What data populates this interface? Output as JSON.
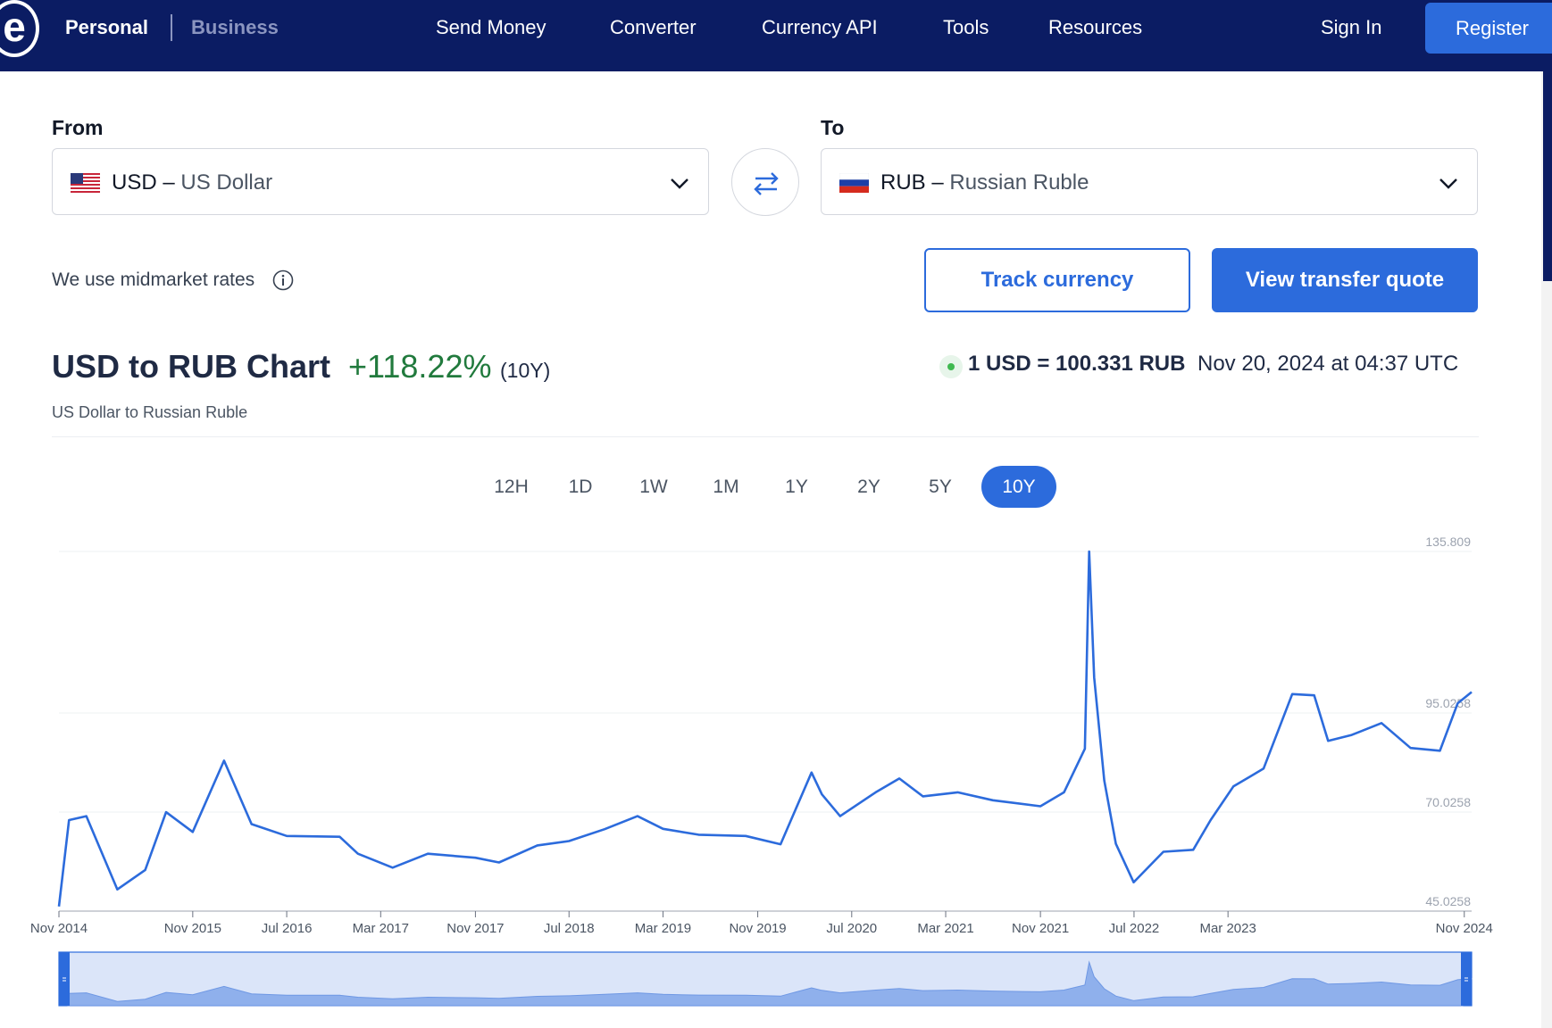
{
  "header": {
    "logo_letter": "e",
    "personal": "Personal",
    "business": "Business",
    "nav": [
      "Send Money",
      "Converter",
      "Currency API",
      "Tools",
      "Resources"
    ],
    "sign_in": "Sign In",
    "register": "Register",
    "bg_color": "#0b1c63"
  },
  "converter": {
    "from_label": "From",
    "from_code": "USD",
    "from_name": "US Dollar",
    "from_flag": "us-flag",
    "to_label": "To",
    "to_code": "RUB",
    "to_name": "Russian Ruble",
    "to_flag": "ru-flag",
    "dash": "–",
    "midmarket_text": "We use midmarket rates",
    "track_button": "Track currency",
    "quote_button": "View transfer quote",
    "accent": "#2c6bdc"
  },
  "chart_header": {
    "title": "USD to RUB Chart",
    "change": "+118.22%",
    "change_period": "(10Y)",
    "subtitle": "US Dollar to Russian Ruble",
    "rate": "1 USD = 100.331 RUB",
    "rate_time": "Nov 20, 2024 at 04:37 UTC",
    "change_color": "#217a3d"
  },
  "range_tabs": {
    "items": [
      "12H",
      "1D",
      "1W",
      "1M",
      "1Y",
      "2Y",
      "5Y",
      "10Y"
    ],
    "active": "10Y"
  },
  "chart_data": {
    "type": "line",
    "title": "USD to RUB Chart",
    "series": [
      {
        "name": "USD to RUB",
        "x": [
          "2014-11-20",
          "2014-12-16",
          "2015-01-30",
          "2015-04-20",
          "2015-07-01",
          "2015-08-24",
          "2015-11-01",
          "2016-01-21",
          "2016-04-01",
          "2016-07-01",
          "2016-11-15",
          "2017-01-01",
          "2017-04-01",
          "2017-07-01",
          "2017-11-01",
          "2018-01-01",
          "2018-04-10",
          "2018-07-01",
          "2018-10-01",
          "2018-12-25",
          "2019-03-01",
          "2019-06-01",
          "2019-10-01",
          "2019-12-30",
          "2020-03-19",
          "2020-04-15",
          "2020-06-01",
          "2020-09-01",
          "2020-11-01",
          "2021-01-01",
          "2021-04-01",
          "2021-07-01",
          "2021-11-01",
          "2022-01-01",
          "2022-02-24",
          "2022-03-07",
          "2022-03-20",
          "2022-04-15",
          "2022-05-15",
          "2022-06-30",
          "2022-09-15",
          "2022-12-01",
          "2023-01-15",
          "2023-03-15",
          "2023-06-01",
          "2023-08-14",
          "2023-10-10",
          "2023-11-15",
          "2024-01-15",
          "2024-04-01",
          "2024-06-15",
          "2024-08-30",
          "2024-10-15",
          "2024-11-20"
        ],
        "values": [
          46.2,
          68.0,
          69.0,
          50.5,
          55.4,
          70.0,
          65.0,
          83.0,
          67.0,
          64.0,
          63.8,
          59.5,
          56.0,
          59.5,
          58.5,
          57.3,
          61.6,
          62.7,
          65.7,
          69.0,
          65.8,
          64.3,
          64.0,
          61.9,
          80.0,
          74.5,
          69.0,
          75.0,
          78.5,
          74.0,
          75.0,
          73.0,
          71.5,
          75.0,
          86.0,
          135.8,
          104.0,
          78.0,
          62.0,
          52.3,
          60.0,
          60.5,
          68.0,
          76.5,
          81.0,
          99.8,
          99.5,
          88.0,
          89.5,
          92.5,
          86.2,
          85.5,
          97.5,
          100.331
        ]
      }
    ],
    "y_ticks": [
      135.809,
      "95.0258",
      "70.0258",
      "45.0258"
    ],
    "ylim": [
      45.0258,
      135.809
    ],
    "x_ticks": [
      "Nov 2014",
      "Nov 2015",
      "Jul 2016",
      "Mar 2017",
      "Nov 2017",
      "Jul 2018",
      "Mar 2019",
      "Nov 2019",
      "Jul 2020",
      "Mar 2021",
      "Nov 2021",
      "Jul 2022",
      "Mar 2023",
      "Nov 2024"
    ],
    "grid": true,
    "line_color": "#2c6bdc"
  }
}
